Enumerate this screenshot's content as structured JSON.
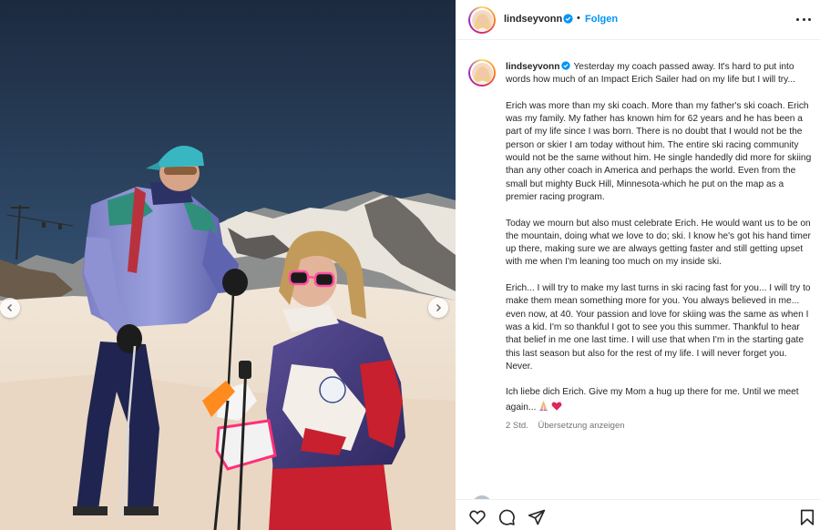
{
  "post": {
    "username": "lindseyvonn",
    "dot": "•",
    "follow_label": "Folgen",
    "caption": [
      "Yesterday my coach passed away. It's hard to put into words how much of an Impact Erich Sailer had on my life but I will try...",
      "Erich was more than my ski coach. More than my father's ski coach. Erich was my family. My father has known him for 62 years and he has been a part of my life since I was born. There is no doubt that I would not be the person or skier I am today without him. The entire ski racing community would not be the same without him. He single handedly did more for skiing than any other coach in America and perhaps the world. Even from the small but mighty Buck Hill, Minnesota-which he put on the map as a premier racing program.",
      "Today we mourn but also must celebrate Erich. He would want us to be on the mountain, doing what we love to do; ski. I know he's got his hand timer up there, making sure we are always getting faster and still getting upset with me when I'm leaning too much on my inside ski.",
      "Erich... I will try to make my last turns in ski racing fast for you... I will try to make them mean something more for you. You always believed in me... even now, at 40. Your passion and love for skiing was the same as when I was a kid. I'm so thankful I got to see you this summer. Thankful to hear that belief in me one last time. I will use that when I'm in the starting gate this last season but also for the rest of my life. I will never forget you. Never."
    ],
    "last_line": "Ich liebe dich Erich. Give my Mom a hug up there for me. Until we meet again...",
    "time": "2 Std.",
    "translation_label": "Übersetzung anzeigen"
  },
  "icons": {
    "verified": "verified-badge-icon",
    "more": "more-options-icon",
    "like": "heart-icon",
    "comment": "comment-icon",
    "share": "paper-plane-icon",
    "save": "bookmark-icon",
    "prev": "chevron-left-icon",
    "next": "chevron-right-icon",
    "emoji_praying": "praying-hands-emoji",
    "emoji_heart": "red-heart-emoji"
  },
  "colors": {
    "link": "#0095f6",
    "verified": "#0095f6",
    "text": "#262626",
    "muted": "#737373",
    "heart_emoji": "#e0245e"
  }
}
